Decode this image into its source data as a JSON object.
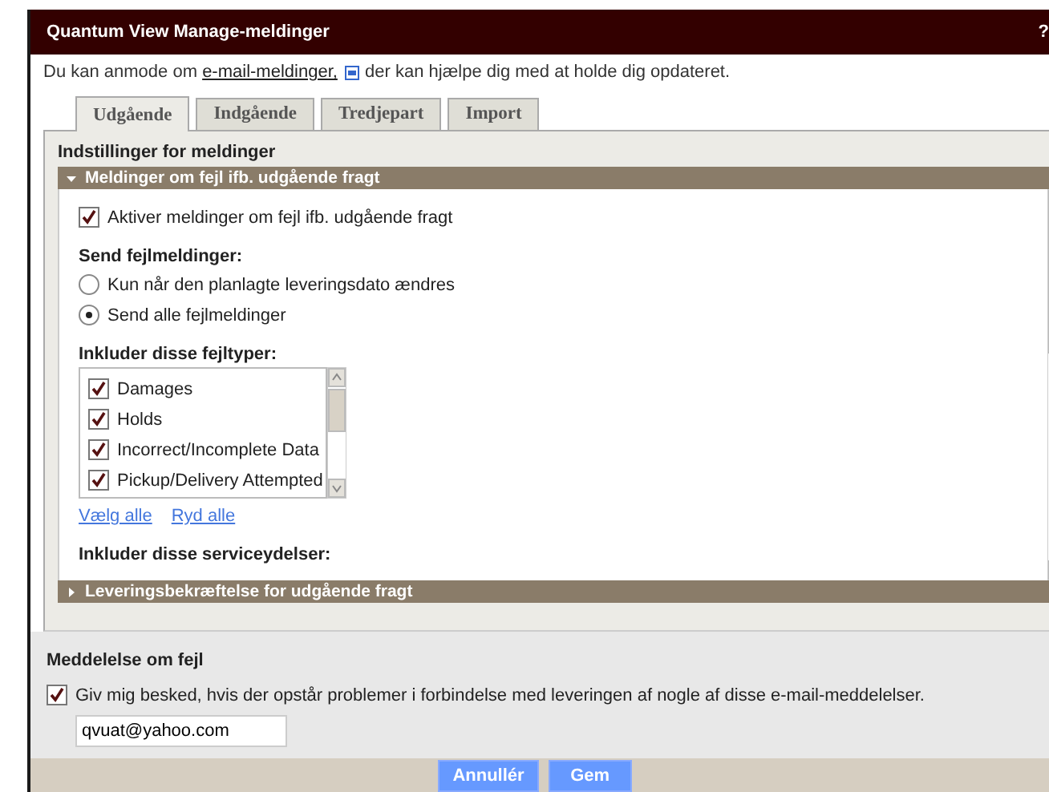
{
  "window": {
    "title": "Quantum View Manage-meldinger",
    "help": "?"
  },
  "intro": {
    "before": "Du kan anmode om ",
    "link": "e-mail-meldinger,",
    "after": " der kan hjælpe dig med at holde dig opdateret."
  },
  "tabs": [
    {
      "label": "Udgående",
      "selected": true
    },
    {
      "label": "Indgående",
      "selected": false
    },
    {
      "label": "Tredjepart",
      "selected": false
    },
    {
      "label": "Import",
      "selected": false
    }
  ],
  "settings": {
    "heading": "Indstillinger for meldinger",
    "sections": [
      {
        "title": "Meldinger om fejl ifb. udgående fragt",
        "expanded": true
      },
      {
        "title": "Leveringsbekræftelse for udgående fragt",
        "expanded": false
      }
    ]
  },
  "exception_panel": {
    "enable": {
      "label": "Aktiver meldinger om fejl ifb. udgående fragt",
      "checked": true
    },
    "send_heading": "Send fejlmeldinger:",
    "send_options": [
      {
        "label": "Kun når den planlagte leveringsdato ændres",
        "selected": false
      },
      {
        "label": "Send alle fejlmeldinger",
        "selected": true
      }
    ],
    "types_heading": "Inkluder disse fejltyper:",
    "types": [
      {
        "label": "Damages",
        "checked": true
      },
      {
        "label": "Holds",
        "checked": true
      },
      {
        "label": "Incorrect/Incomplete Data",
        "checked": true
      },
      {
        "label": "Pickup/Delivery Attempted",
        "checked": true
      }
    ],
    "select_all": "Vælg alle",
    "clear_all": "Ryd alle",
    "services_heading": "Inkluder disse serviceydelser:"
  },
  "failure_notice": {
    "heading": "Meddelelse om fejl",
    "notify": {
      "label": "Giv mig besked, hvis der opstår problemer i forbindelse med leveringen af nogle af disse e-mail-meddelelser.",
      "checked": true
    },
    "email": "qvuat@yahoo.com"
  },
  "buttons": [
    "Annullér",
    "Gem"
  ]
}
